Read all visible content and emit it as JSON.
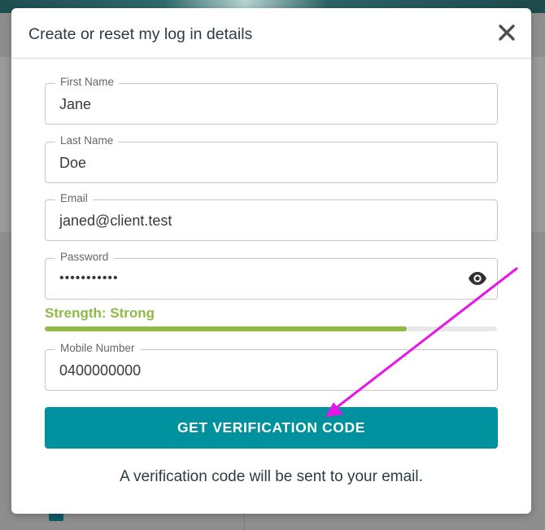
{
  "modal": {
    "title": "Create or reset my log in details",
    "close_icon": "close-icon"
  },
  "fields": {
    "first_name": {
      "label": "First Name",
      "value": "Jane"
    },
    "last_name": {
      "label": "Last Name",
      "value": "Doe"
    },
    "email": {
      "label": "Email",
      "value": "janed@client.test"
    },
    "password": {
      "label": "Password",
      "value": "•••••••••••",
      "toggle_icon": "eye-icon"
    },
    "mobile": {
      "label": "Mobile Number",
      "value": "0400000000"
    }
  },
  "strength": {
    "label": "Strength: Strong",
    "level": 0.8,
    "color": "#8fbb45"
  },
  "actions": {
    "verify_label": "GET VERIFICATION CODE",
    "helper_text": "A verification code will be sent to your email."
  },
  "colors": {
    "accent": "#00919e",
    "annotation": "#e815e8"
  }
}
